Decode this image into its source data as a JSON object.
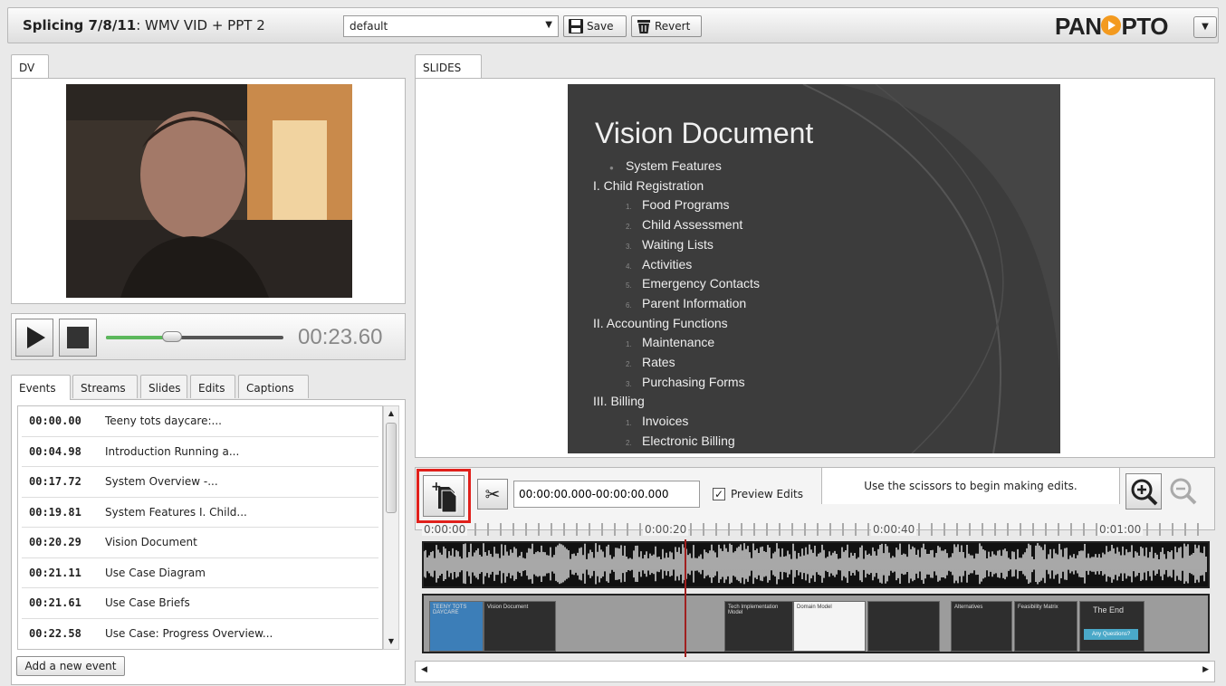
{
  "header": {
    "session_title": "Splicing 7/8/11",
    "session_subtitle": ": WMV VID + PPT 2",
    "layout_select": "default",
    "save_label": "Save",
    "revert_label": "Revert",
    "logo_part1": "PAN",
    "logo_part2": "PTO"
  },
  "dv": {
    "tab_label": "DV"
  },
  "player": {
    "time": "00:23.60",
    "progress": 0.37
  },
  "event_tabs": [
    "Events",
    "Streams",
    "Slides",
    "Edits",
    "Captions"
  ],
  "events": [
    {
      "time": "00:00.00",
      "title": "Teeny tots daycare:..."
    },
    {
      "time": "00:04.98",
      "title": "Introduction  Running a..."
    },
    {
      "time": "00:17.72",
      "title": "System Overview  -..."
    },
    {
      "time": "00:19.81",
      "title": "System Features I. Child..."
    },
    {
      "time": "00:20.29",
      "title": "Vision Document"
    },
    {
      "time": "00:21.11",
      "title": "Use Case  Diagram"
    },
    {
      "time": "00:21.61",
      "title": "Use Case Briefs"
    },
    {
      "time": "00:22.58",
      "title": "Use Case: Progress Overview..."
    }
  ],
  "add_event_label": "Add a new event",
  "slides": {
    "tab_label": "SLIDES",
    "title": "Vision Document",
    "lines": [
      {
        "num": "●",
        "text": "System Features",
        "indent": 1
      },
      {
        "num": "",
        "text": "I. Child Registration",
        "indent": 0
      },
      {
        "num": "1.",
        "text": "Food Programs",
        "indent": 2
      },
      {
        "num": "2.",
        "text": "Child Assessment",
        "indent": 2
      },
      {
        "num": "3.",
        "text": "Waiting Lists",
        "indent": 2
      },
      {
        "num": "4.",
        "text": "Activities",
        "indent": 2
      },
      {
        "num": "5.",
        "text": "Emergency Contacts",
        "indent": 2
      },
      {
        "num": "6.",
        "text": "Parent Information",
        "indent": 2
      },
      {
        "num": "",
        "text": "II. Accounting Functions",
        "indent": 0
      },
      {
        "num": "1.",
        "text": "Maintenance",
        "indent": 2
      },
      {
        "num": "2.",
        "text": "Rates",
        "indent": 2
      },
      {
        "num": "3.",
        "text": "Purchasing Forms",
        "indent": 2
      },
      {
        "num": "",
        "text": "III. Billing",
        "indent": 0
      },
      {
        "num": "1.",
        "text": "Invoices",
        "indent": 2
      },
      {
        "num": "2.",
        "text": "Electronic Billing",
        "indent": 2
      }
    ]
  },
  "editor": {
    "range_value": "00:00:00.000-00:00:00.000",
    "preview_label": "Preview Edits",
    "preview_checked": "✓",
    "hint": "Use the scissors to begin making edits."
  },
  "timeline": {
    "ruler_labels": [
      "0:00:00",
      "0:00:20",
      "0:00:40",
      "0:01:00"
    ],
    "thumbs": [
      {
        "title": "TEENY TOTS DAYCARE"
      },
      {
        "title": "Vision Document"
      },
      {
        "title": ""
      },
      {
        "title": "Tech Implementation Model"
      },
      {
        "title": "Domain Model"
      },
      {
        "title": ""
      },
      {
        "title": "Alternatives"
      },
      {
        "title": "Feasibility Matrix"
      },
      {
        "title": "The End"
      }
    ],
    "end_button": "Any Questions?"
  },
  "icons": {
    "dropdown": "chevron-down-icon",
    "save": "floppy-disk-icon",
    "revert": "trash-icon",
    "add_slide": "add-page-icon",
    "scissors": "scissors-icon",
    "zoom_in": "zoom-in-icon",
    "zoom_out": "zoom-out-icon"
  },
  "colors": {
    "highlight": "#e0201b",
    "seek_fill": "#5cb85c",
    "logo_accent": "#f39a1f",
    "playhead": "#a02020"
  }
}
